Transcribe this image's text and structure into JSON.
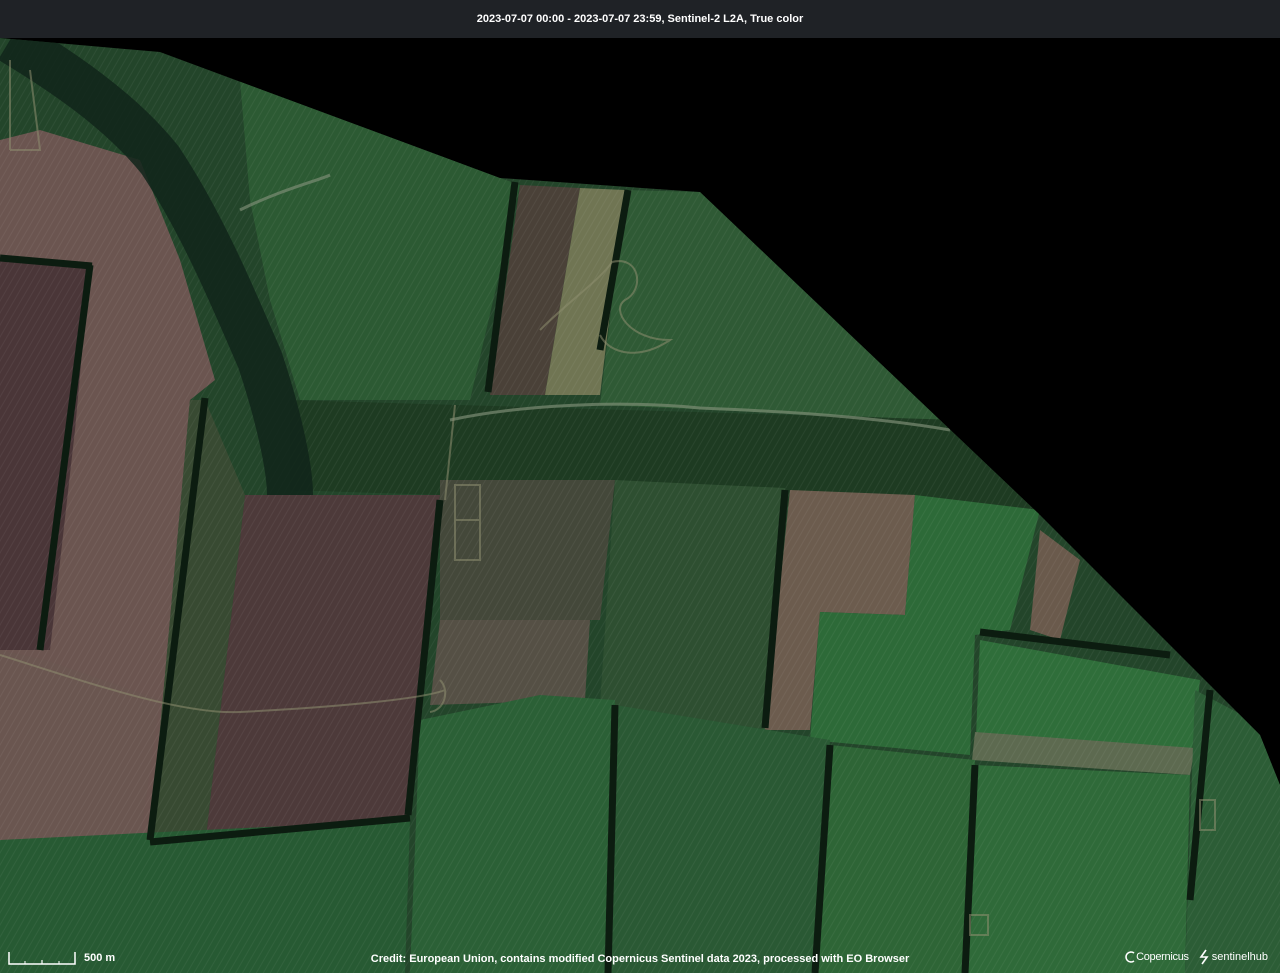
{
  "header": {
    "title": "2023-07-07 00:00 - 2023-07-07 23:59, Sentinel-2 L2A, True color"
  },
  "map": {
    "imagery": "satellite-true-color",
    "colors": {
      "background": "#000000",
      "field_green": "#244b2a",
      "field_brown": "#4a3a35",
      "tree_belt": "#0f2414",
      "track_light": "#8a8a6a"
    }
  },
  "footer": {
    "scale_label": "500 m",
    "credit": "Credit: European Union, contains modified Copernicus Sentinel data 2023, processed with EO Browser",
    "logo_copernicus": "Copernicus",
    "logo_sentinelhub": "sentinelhub"
  },
  "icons": [
    "scale-bar-icon",
    "copernicus-logo-icon",
    "sentinelhub-logo-icon"
  ]
}
